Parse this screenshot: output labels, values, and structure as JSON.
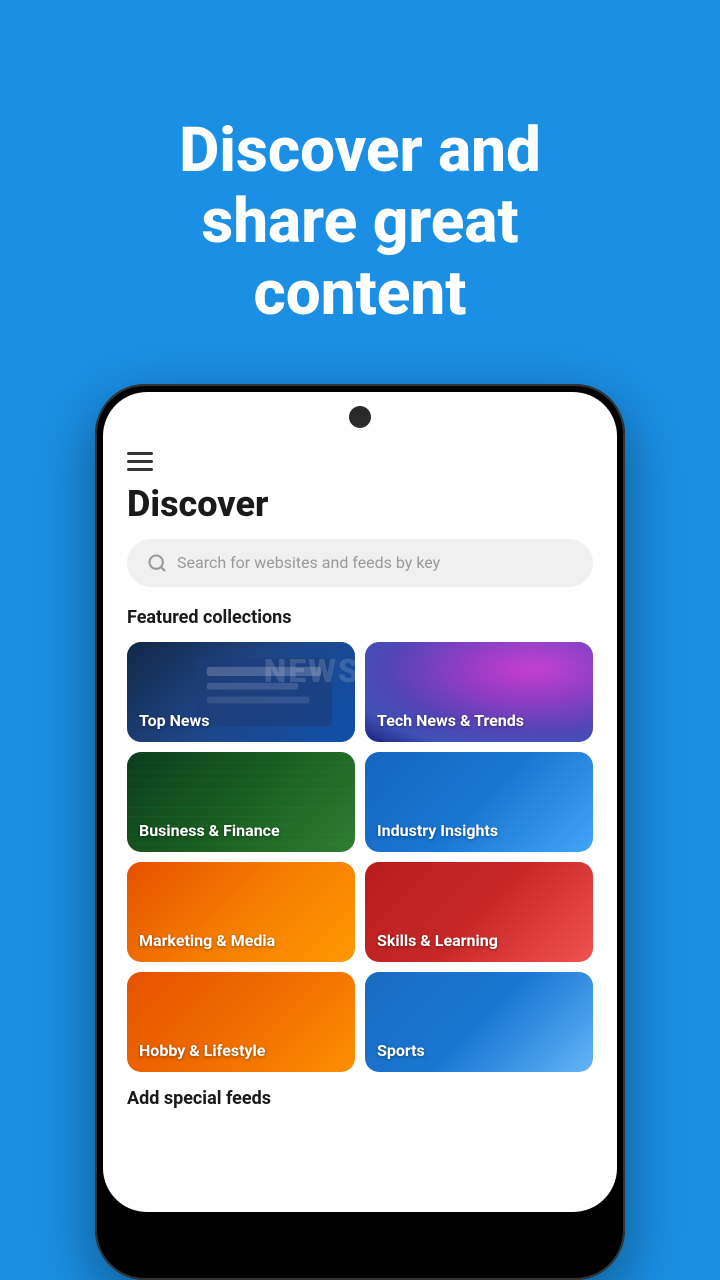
{
  "hero": {
    "title": "Discover and share great content"
  },
  "app": {
    "page_title": "Discover",
    "search_placeholder": "Search for websites and feeds by key",
    "featured_section_label": "Featured collections",
    "add_feeds_label": "Add special feeds"
  },
  "collections": [
    {
      "id": "top-news",
      "label": "Top News",
      "card_class": "card-top-news"
    },
    {
      "id": "tech-news",
      "label": "Tech News & Trends",
      "card_class": "card-tech-news"
    },
    {
      "id": "business",
      "label": "Business & Finance",
      "card_class": "card-business"
    },
    {
      "id": "industry",
      "label": "Industry Insights",
      "card_class": "card-industry"
    },
    {
      "id": "marketing",
      "label": "Marketing & Media",
      "card_class": "card-marketing"
    },
    {
      "id": "skills",
      "label": "Skills & Learning",
      "card_class": "card-skills"
    },
    {
      "id": "hobby",
      "label": "Hobby & Lifestyle",
      "card_class": "card-hobby"
    },
    {
      "id": "sports",
      "label": "Sports",
      "card_class": "card-sports"
    }
  ],
  "icons": {
    "search": "🔍",
    "menu": "☰"
  },
  "colors": {
    "background": "#1a8fe3",
    "hero_text": "#ffffff",
    "page_title": "#1a1a1a",
    "section_title": "#1a1a1a"
  }
}
